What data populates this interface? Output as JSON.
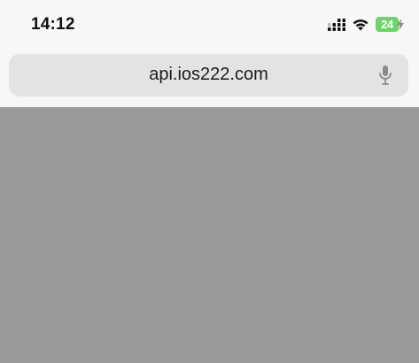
{
  "status_bar": {
    "time": "14:12",
    "battery_level": "24",
    "battery_charging": true,
    "signal_icon": "cellular-signal-icon",
    "wifi_icon": "wifi-icon"
  },
  "address_bar": {
    "url": "api.ios222.com",
    "mic_icon": "microphone-icon"
  },
  "colors": {
    "chrome_background": "#f7f7f7",
    "address_field": "#e3e3e5",
    "content_overlay": "#9a9a9a",
    "battery_green": "#6fd46b"
  }
}
